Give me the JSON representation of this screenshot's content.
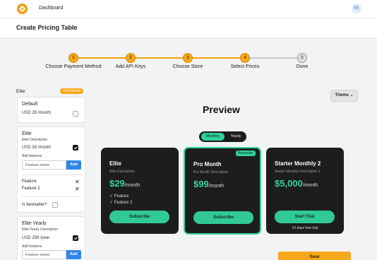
{
  "topbar": {
    "nav": "Dashboard",
    "avatar": "SK"
  },
  "header": {
    "title": "Create Pricing Table"
  },
  "stepper": {
    "steps": [
      {
        "num": "1",
        "label": "Choose Payment Method"
      },
      {
        "num": "2",
        "label": "Add API Keys"
      },
      {
        "num": "3",
        "label": "Choose Store"
      },
      {
        "num": "4",
        "label": "Select Prices"
      },
      {
        "num": "5",
        "label": "Done"
      }
    ],
    "current_step": 4
  },
  "editor": {
    "product_label": "Elite",
    "test_badge": "Test Mode",
    "default_card": {
      "title": "Default",
      "price": "USD 29 /month"
    },
    "elite_card": {
      "title": "Elite",
      "description": "Elite Description",
      "price": "USD 29 /month",
      "add_features": "Add features",
      "feature_placeholder": "Feature name",
      "add_button": "Add",
      "features": [
        "Feature",
        "Feature 2"
      ],
      "bestseller_label": "Is bestseller?"
    },
    "elite_yearly_card": {
      "title": "Elite Yearly",
      "description": "Elite Yearly Description",
      "price": "USD 299 /year",
      "add_features": "Add features",
      "feature_placeholder": "Feature name",
      "add_button": "Add"
    }
  },
  "preview": {
    "theme_button": "Theme",
    "title": "Preview",
    "toggle": {
      "monthly": "Monthly",
      "yearly": "Yearly"
    },
    "cards": {
      "elite": {
        "name": "Elite",
        "description": "Elite Description",
        "price": "$29",
        "per": "/month",
        "features": [
          "✓ Feature",
          "✓ Feature 2"
        ],
        "button": "Subscribe"
      },
      "pro": {
        "name": "Pro Month",
        "description": "Pro Month Description",
        "price": "$99",
        "per": "/month",
        "badge": "Bestseller",
        "button": "Subscribe"
      },
      "starter": {
        "name": "Starter Monthly 2",
        "description": "Starter Monthly Description 2",
        "price": "$5,000",
        "per": "/month",
        "button": "Start Trial",
        "trial_note": "14 days free trial"
      }
    },
    "save_button": "Save"
  },
  "colors": {
    "accent": "#f6a81c",
    "green": "#35d3a0",
    "card_bg": "#1d1d1d",
    "add_blue": "#2f86eb"
  }
}
